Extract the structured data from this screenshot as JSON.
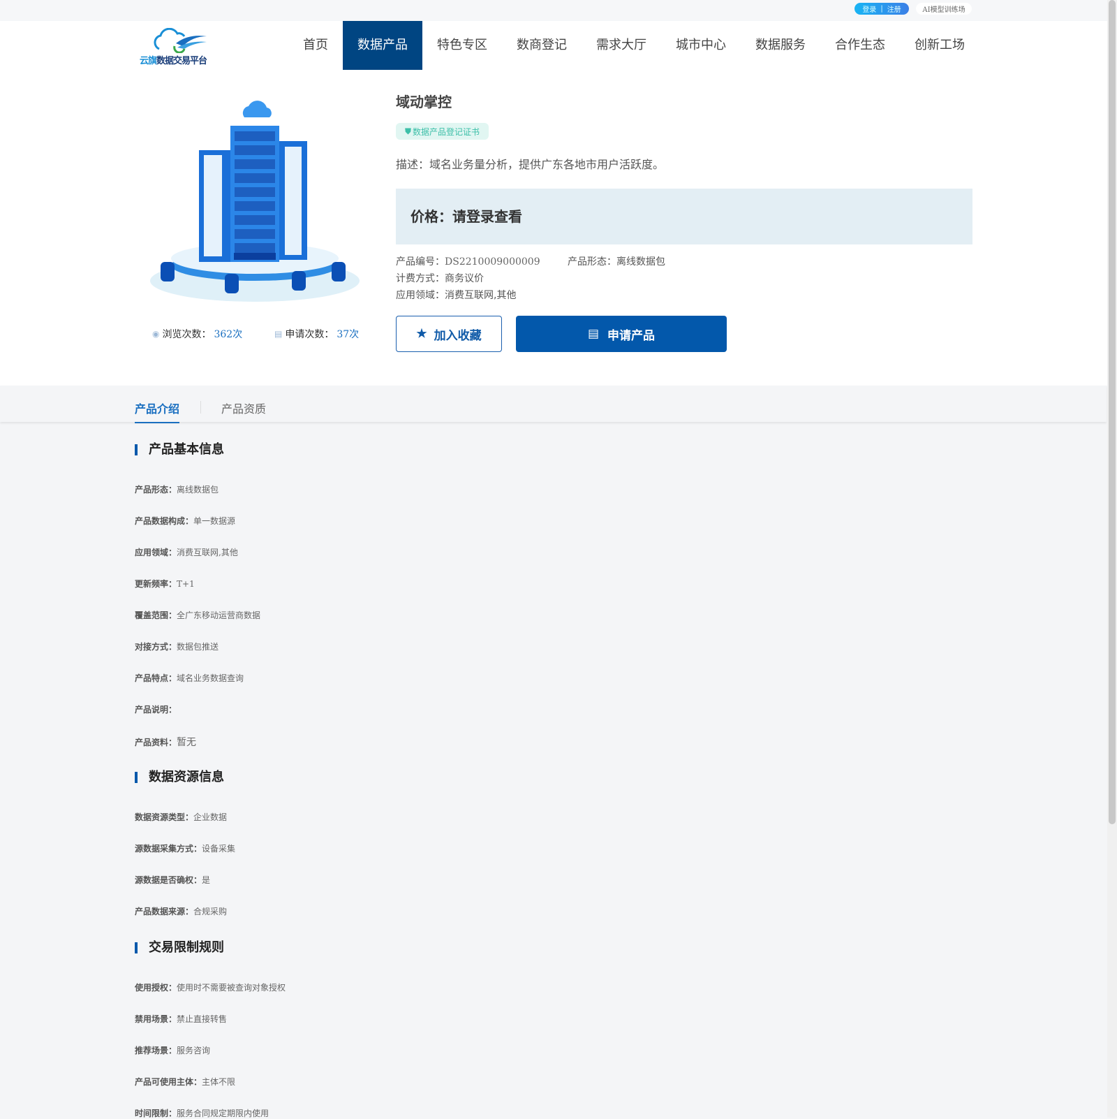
{
  "topbar": {
    "login": "登录",
    "sep": "|",
    "register": "注册",
    "ai": "AI模型训练场"
  },
  "logo": {
    "text_a": "云旗",
    "text_b": "数据交易平台"
  },
  "nav": [
    "首页",
    "数据产品",
    "特色专区",
    "数商登记",
    "需求大厅",
    "城市中心",
    "数据服务",
    "合作生态",
    "创新工场"
  ],
  "product": {
    "title": "域动掌控",
    "badge": "数据产品登记证书",
    "desc": "描述：域名业务量分析，提供广东各地市用户活跃度。",
    "price": "价格：请登录查看",
    "code_label": "产品编号：",
    "code": "DS2210009000009",
    "form_label": "产品形态：",
    "form": "离线数据包",
    "billing_label": "计费方式：",
    "billing": "商务议价",
    "domain_label": "应用领域：",
    "domain": "消费互联网,其他",
    "views_label": "浏览次数：",
    "views": "362次",
    "applies_label": "申请次数：",
    "applies": "37次",
    "fav_btn": "加入收藏",
    "apply_btn": "申请产品"
  },
  "tabs": [
    "产品介绍",
    "产品资质"
  ],
  "sections": [
    {
      "title": "产品基本信息",
      "rows": [
        {
          "k": "产品形态：",
          "v": "离线数据包"
        },
        {
          "k": "产品数据构成：",
          "v": "单一数据源"
        },
        {
          "k": "应用领域：",
          "v": "消费互联网,其他"
        },
        {
          "k": "更新频率：",
          "v": "T+1"
        },
        {
          "k": "覆盖范围：",
          "v": "全广东移动运营商数据"
        },
        {
          "k": "对接方式：",
          "v": "数据包推送"
        },
        {
          "k": "产品特点：",
          "v": "域名业务数据查询"
        },
        {
          "k": "产品说明：",
          "v": ""
        },
        {
          "k": "产品资料：",
          "v": "暂无"
        }
      ]
    },
    {
      "title": "数据资源信息",
      "rows": [
        {
          "k": "数据资源类型：",
          "v": "企业数据"
        },
        {
          "k": "源数据采集方式：",
          "v": "设备采集"
        },
        {
          "k": "源数据是否确权：",
          "v": "是"
        },
        {
          "k": "产品数据来源：",
          "v": "合规采购"
        }
      ]
    },
    {
      "title": "交易限制规则",
      "rows": [
        {
          "k": "使用授权：",
          "v": "使用时不需要被查询对象授权"
        },
        {
          "k": "禁用场景：",
          "v": "禁止直接转售"
        },
        {
          "k": "推荐场景：",
          "v": "服务咨询"
        },
        {
          "k": "产品可使用主体：",
          "v": "主体不限"
        },
        {
          "k": "时间限制：",
          "v": "服务合同规定期限内使用"
        }
      ]
    }
  ]
}
